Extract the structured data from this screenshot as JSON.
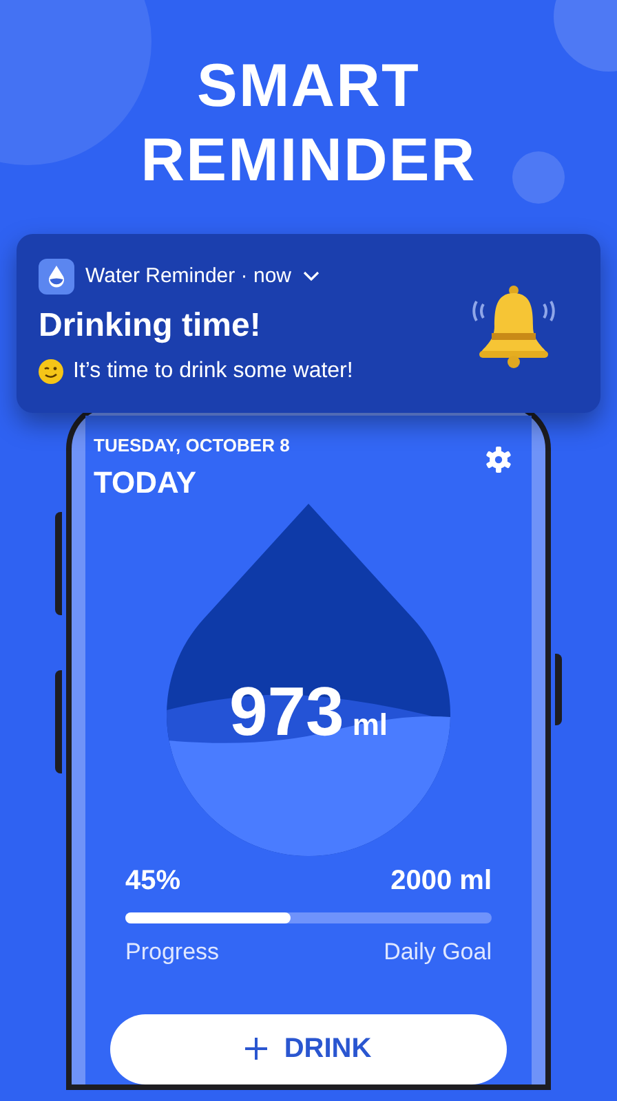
{
  "headline": "SMART REMINDER",
  "notification": {
    "app_name": "Water Reminder",
    "separator": "·",
    "time": "now",
    "title": "Drinking time!",
    "message": "It’s time to drink some water!"
  },
  "screen": {
    "date": "TUESDAY, OCTOBER 8",
    "heading": "TODAY",
    "amount": "973",
    "amount_unit": "ml",
    "progress": {
      "percent": "45%",
      "goal": "2000 ml",
      "level": 0.45,
      "left_label": "Progress",
      "right_label": "Daily Goal"
    },
    "drink_button": "DRINK"
  }
}
